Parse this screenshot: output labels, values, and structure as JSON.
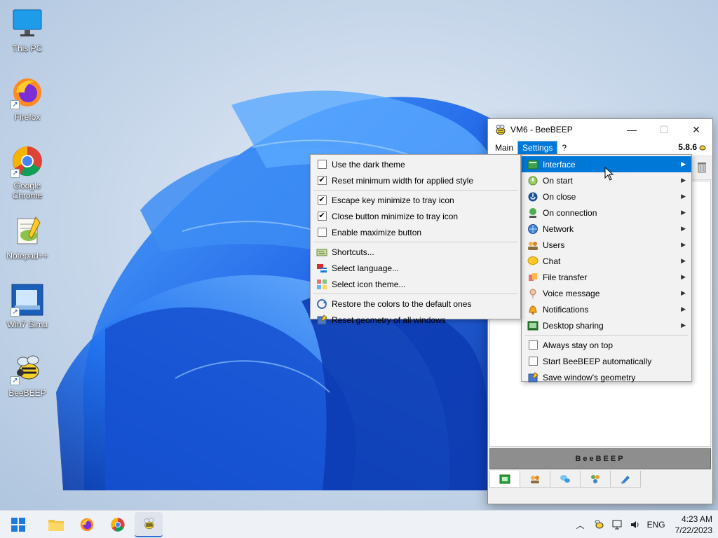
{
  "desktop": {
    "icons": [
      {
        "label": "This PC",
        "icon": "monitor-icon"
      },
      {
        "label": "Firefox",
        "icon": "firefox-icon"
      },
      {
        "label": "Google Chrome",
        "icon": "chrome-icon"
      },
      {
        "label": "Notepad++",
        "icon": "notepadpp-icon"
      },
      {
        "label": "Win7 Simu",
        "icon": "win7-simu-icon"
      },
      {
        "label": "BeeBEEP",
        "icon": "beebeep-icon"
      }
    ]
  },
  "window": {
    "title": "VM6 - BeeBEEP",
    "minimize": "—",
    "maximize": "☐",
    "close": "✕",
    "menubar": [
      {
        "label": "Main",
        "active": false
      },
      {
        "label": "Settings",
        "active": true
      },
      {
        "label": "?",
        "active": false
      }
    ],
    "version": "5.8.6",
    "banner": "BeeBEEP",
    "tabs": [
      "chat-tab-icon",
      "users-tab-icon",
      "groups-tab-icon",
      "network-tab-icon",
      "files-tab-icon"
    ]
  },
  "settings_menu": {
    "items": [
      {
        "label": "Interface",
        "icon": "interface-icon",
        "submenu": true,
        "highlighted": true
      },
      {
        "label": "On start",
        "icon": "on-start-icon",
        "submenu": true
      },
      {
        "label": "On close",
        "icon": "on-close-icon",
        "submenu": true
      },
      {
        "label": "On connection",
        "icon": "on-connection-icon",
        "submenu": true
      },
      {
        "label": "Network",
        "icon": "network-icon",
        "submenu": true
      },
      {
        "label": "Users",
        "icon": "users-icon",
        "submenu": true
      },
      {
        "label": "Chat",
        "icon": "chat-icon",
        "submenu": true
      },
      {
        "label": "File transfer",
        "icon": "file-transfer-icon",
        "submenu": true
      },
      {
        "label": "Voice message",
        "icon": "voice-message-icon",
        "submenu": true
      },
      {
        "label": "Notifications",
        "icon": "notifications-icon",
        "submenu": true
      },
      {
        "label": "Desktop sharing",
        "icon": "desktop-sharing-icon",
        "submenu": true
      }
    ],
    "checks": [
      {
        "label": "Always stay on top",
        "checked": false
      },
      {
        "label": "Start BeeBEEP automatically",
        "checked": false
      }
    ],
    "last": {
      "label": "Save window's geometry",
      "icon": "save-geometry-icon"
    }
  },
  "interface_submenu": {
    "group1": [
      {
        "label": "Use the dark theme",
        "checked": false
      },
      {
        "label": "Reset minimum width for applied style",
        "checked": true
      }
    ],
    "group2": [
      {
        "label": "Escape key minimize to tray icon",
        "checked": true
      },
      {
        "label": "Close button minimize to tray icon",
        "checked": true
      },
      {
        "label": "Enable maximize button",
        "checked": false
      }
    ],
    "group3": [
      {
        "label": "Shortcuts...",
        "icon": "shortcuts-icon"
      },
      {
        "label": "Select language...",
        "icon": "language-icon"
      },
      {
        "label": "Select icon theme...",
        "icon": "icon-theme-icon"
      }
    ],
    "group4": [
      {
        "label": "Restore the colors to the default ones",
        "icon": "restore-colors-icon"
      },
      {
        "label": "Reset geometry of all windows",
        "icon": "reset-geometry-icon"
      }
    ]
  },
  "taskbar": {
    "apps": [
      "start-icon",
      "file-explorer-icon",
      "firefox-icon",
      "chrome-icon",
      "beebeep-icon"
    ],
    "language": "ENG",
    "time": "4:23 AM",
    "date": "7/22/2023"
  },
  "colors": {
    "highlight": "#0078d7",
    "wallpaper_bg": "#c9d8ea",
    "bloom": "#1a63e8"
  }
}
